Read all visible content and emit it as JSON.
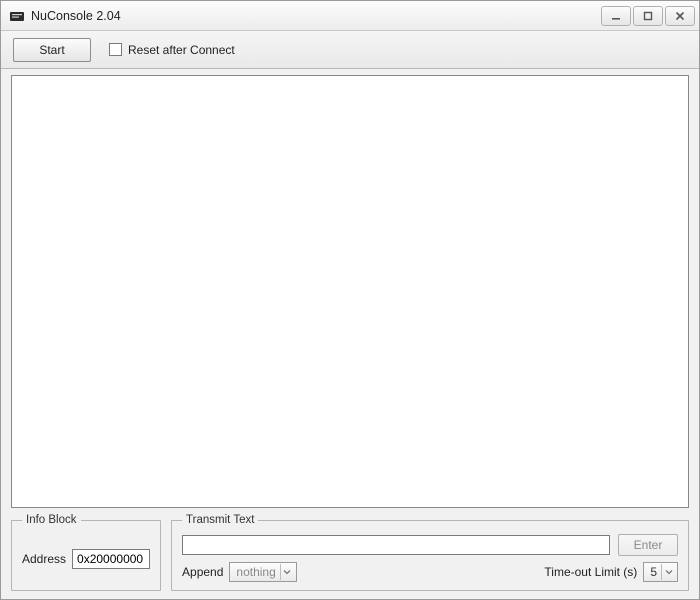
{
  "window": {
    "title": "NuConsole 2.04"
  },
  "toolbar": {
    "start_label": "Start",
    "reset_checkbox_label": "Reset after Connect",
    "reset_checked": false
  },
  "info_block": {
    "legend": "Info Block",
    "address_label": "Address",
    "address_value": "0x20000000"
  },
  "transmit": {
    "legend": "Transmit Text",
    "input_value": "",
    "enter_label": "Enter",
    "append_label": "Append",
    "append_selected": "nothing",
    "timeout_label": "Time-out Limit (s)",
    "timeout_selected": "5"
  }
}
